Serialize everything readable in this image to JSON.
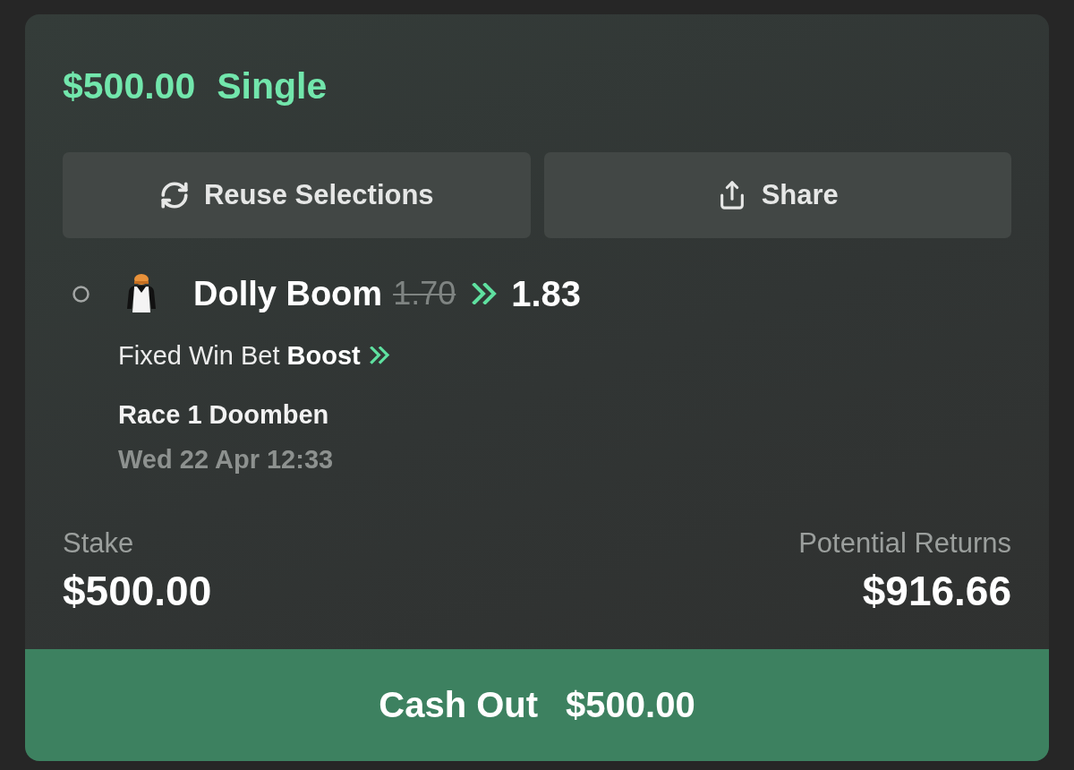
{
  "bet": {
    "amount": "$500.00",
    "type": "Single"
  },
  "actions": [
    {
      "kind": "reuse",
      "label": "Reuse Selections"
    },
    {
      "kind": "share",
      "label": "Share"
    }
  ],
  "selection": {
    "runner": "Dolly Boom",
    "old_odds": "1.70",
    "new_odds": "1.83",
    "bet_type": "Fixed Win Bet **Boost**",
    "race": "Race 1 Doomben",
    "start_time": "Wed 22 Apr 12:33"
  },
  "stake": {
    "label": "Stake",
    "value": "$500.00"
  },
  "returns": {
    "label": "Potential Returns",
    "value": "$916.66"
  },
  "cash_out": {
    "label": "Cash Out",
    "amount": "$500.00"
  }
}
